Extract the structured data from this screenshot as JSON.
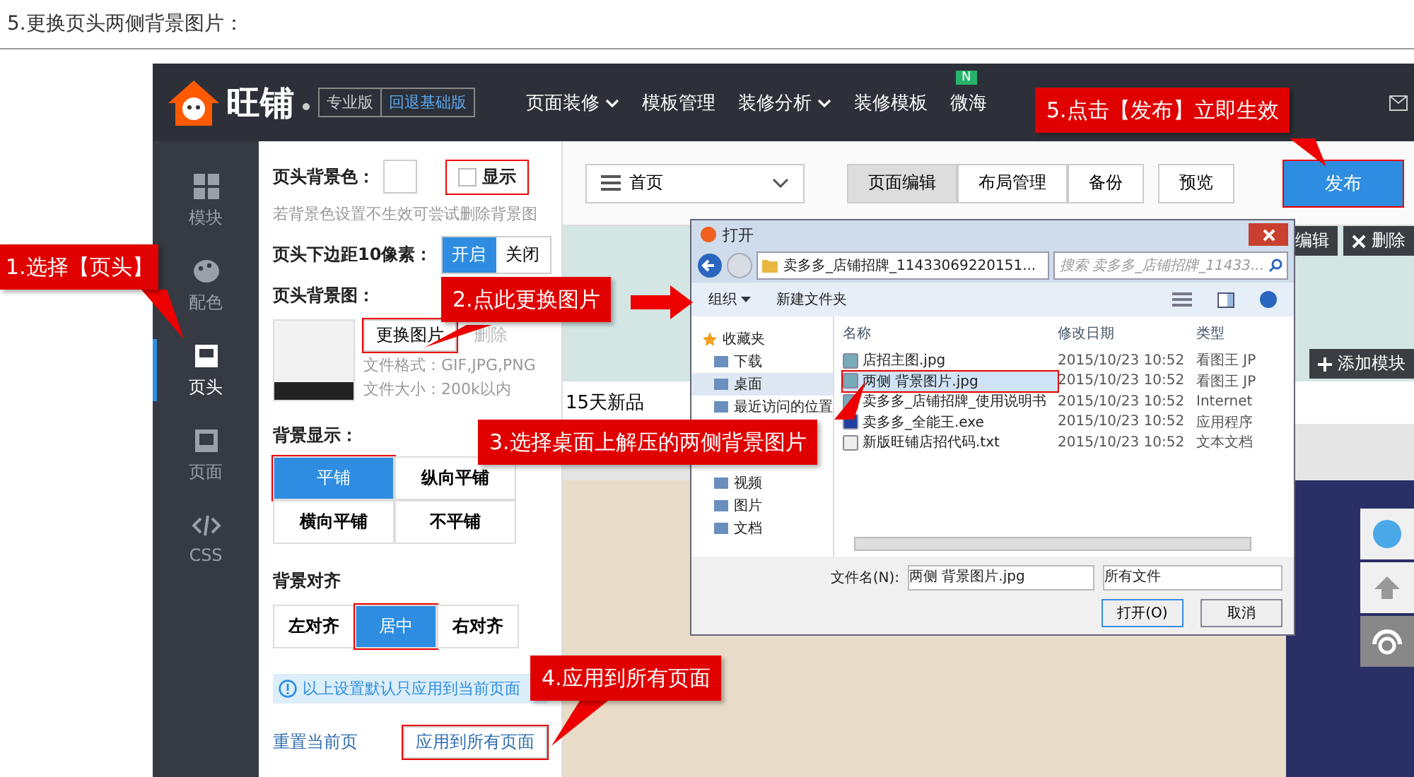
{
  "caption": "5.更换页头两侧背景图片：",
  "topbar": {
    "logo_text": "旺铺",
    "edition": "专业版",
    "fallback_link": "回退基础版",
    "nav": [
      {
        "label": "页面装修",
        "dropdown": true
      },
      {
        "label": "模板管理",
        "dropdown": false
      },
      {
        "label": "装修分析",
        "dropdown": true
      },
      {
        "label": "装修模板",
        "dropdown": false
      },
      {
        "label": "微海",
        "dropdown": false,
        "badge": "N"
      }
    ]
  },
  "sidebar": {
    "items": [
      {
        "label": "模块",
        "selected": false
      },
      {
        "label": "配色",
        "selected": false
      },
      {
        "label": "页头",
        "selected": true
      },
      {
        "label": "页面",
        "selected": false
      },
      {
        "label": "CSS",
        "selected": false
      }
    ]
  },
  "settings": {
    "bg_color_label": "页头背景色：",
    "show_checkbox": {
      "label": "显示",
      "checked": false
    },
    "show_checkbox_annotation_frame": true,
    "bg_hint": "若背景色设置不生效可尝试删除背景图",
    "margin_label": "页头下边距10像素：",
    "margin_toggle": [
      {
        "label": "开启",
        "selected": true
      },
      {
        "label": "关闭",
        "selected": false
      }
    ],
    "bg_image_label": "页头背景图：",
    "replace_button": {
      "label": "更换图片",
      "highlighted": true
    },
    "delete_link": "删除",
    "file_format": "文件格式：GIF,JPG,PNG",
    "file_size": "文件大小：200k以内",
    "display_label": "背景显示：",
    "display_options": [
      {
        "label": "平铺",
        "selected": true,
        "highlighted": true
      },
      {
        "label": "纵向平铺",
        "selected": false,
        "highlighted": false
      },
      {
        "label": "横向平铺",
        "selected": false,
        "highlighted": false
      },
      {
        "label": "不平铺",
        "selected": false,
        "highlighted": false
      }
    ],
    "align_label": "背景对齐",
    "align_options": [
      {
        "label": "左对齐",
        "selected": false,
        "highlighted": false
      },
      {
        "label": "居中",
        "selected": true,
        "highlighted": true
      },
      {
        "label": "右对齐",
        "selected": false,
        "highlighted": false
      }
    ],
    "info": "以上设置默认只应用到当前页面",
    "reset_link": "重置当前页",
    "apply_button": {
      "label": "应用到所有页面",
      "highlighted": true
    }
  },
  "toolbar": {
    "page_select": "首页",
    "mode_tabs": [
      {
        "label": "页面编辑",
        "selected": true
      },
      {
        "label": "布局管理",
        "selected": false
      },
      {
        "label": "备份",
        "selected": false
      }
    ],
    "preview_button": "预览",
    "publish_button": {
      "label": "发布",
      "highlighted": true
    }
  },
  "preview": {
    "edit_button": "编辑",
    "delete_button": "删除",
    "add_module_button": "添加模块",
    "section_title": "15天新品"
  },
  "dialog": {
    "title": "打开",
    "path": "卖多多_店铺招牌_11433069220151...",
    "search_placeholder": "搜索 卖多多_店铺招牌_11433...",
    "organize": "组织",
    "new_folder": "新建文件夹",
    "nav": [
      {
        "label": "收藏夹",
        "selected": false
      },
      {
        "label": "下载",
        "selected": false
      },
      {
        "label": "桌面",
        "selected": true
      },
      {
        "label": "最近访问的位置",
        "selected": false
      },
      {
        "label": "视频",
        "selected": false
      },
      {
        "label": "图片",
        "selected": false
      },
      {
        "label": "文档",
        "selected": false
      }
    ],
    "columns": [
      "名称",
      "修改日期",
      "类型"
    ],
    "files": [
      {
        "name": "店招主图.jpg",
        "date": "2015/10/23 10:52",
        "type": "看图王 JP",
        "selected": false,
        "highlighted": false
      },
      {
        "name": "两侧 背景图片.jpg",
        "date": "2015/10/23 10:52",
        "type": "看图王 JP",
        "selected": true,
        "highlighted": true
      },
      {
        "name": "卖多多_店铺招牌_使用说明书",
        "date": "2015/10/23 10:52",
        "type": "Internet",
        "selected": false,
        "highlighted": false
      },
      {
        "name": "卖多多_全能王.exe",
        "date": "2015/10/23 10:52",
        "type": "应用程序",
        "selected": false,
        "highlighted": false
      },
      {
        "name": "新版旺铺店招代码.txt",
        "date": "2015/10/23 10:52",
        "type": "文本文档",
        "selected": false,
        "highlighted": false
      }
    ],
    "filename_label": "文件名(N):",
    "filename": "两侧 背景图片.jpg",
    "filetype": "所有文件",
    "open_button": "打开(O)",
    "cancel_button": "取消"
  },
  "callouts": [
    "1.选择【页头】",
    "2.点此更换图片",
    "3.选择桌面上解压的两侧背景图片",
    "4.应用到所有页面",
    "5.点击【发布】立即生效"
  ]
}
